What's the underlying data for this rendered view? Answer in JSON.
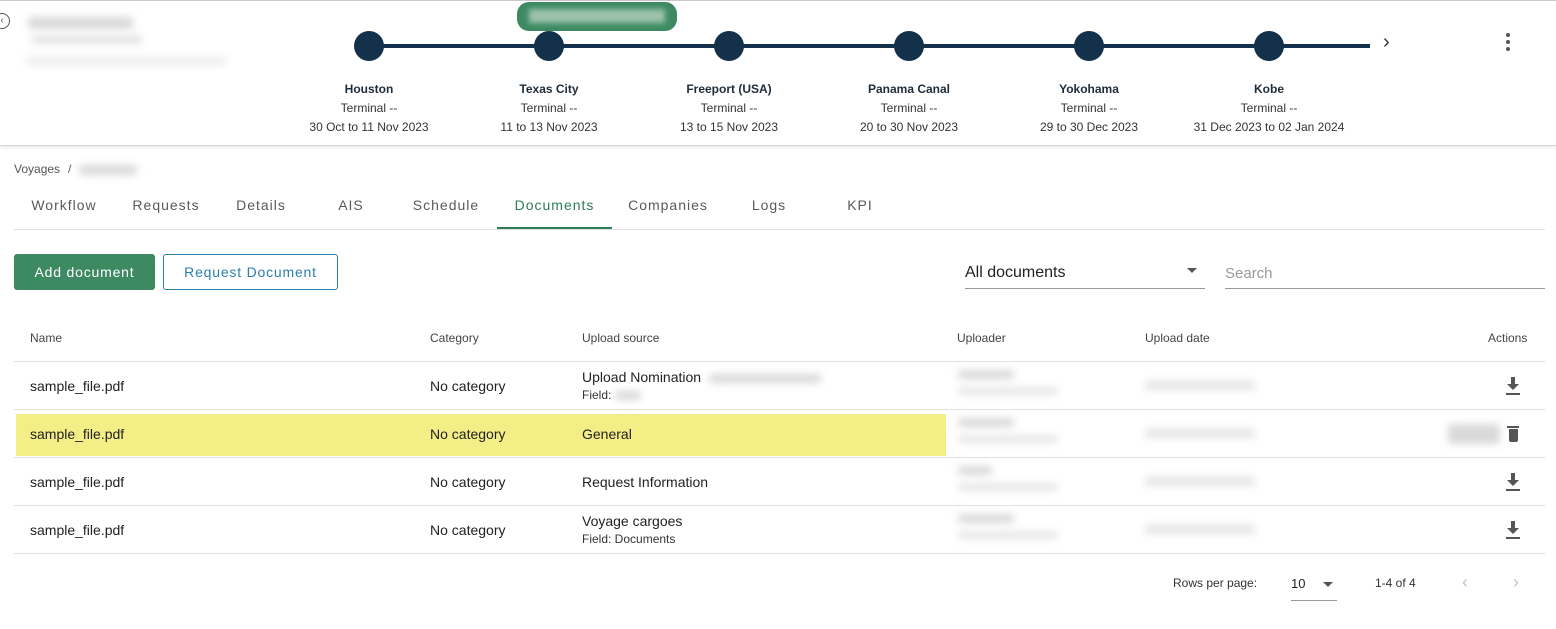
{
  "header": {
    "status_pill_text": "",
    "next_icon": "chevron-right-icon",
    "more_icon": "more-vert-icon"
  },
  "timeline": {
    "stops": [
      {
        "port": "Houston",
        "terminal": "Terminal --",
        "dates": "30 Oct to 11 Nov 2023"
      },
      {
        "port": "Texas City",
        "terminal": "Terminal --",
        "dates": "11 to 13 Nov 2023"
      },
      {
        "port": "Freeport (USA)",
        "terminal": "Terminal --",
        "dates": "13 to 15 Nov 2023"
      },
      {
        "port": "Panama Canal",
        "terminal": "Terminal --",
        "dates": "20 to 30 Nov 2023"
      },
      {
        "port": "Yokohama",
        "terminal": "Terminal --",
        "dates": "29 to 30 Dec 2023"
      },
      {
        "port": "Kobe",
        "terminal": "Terminal --",
        "dates": "31 Dec 2023 to 02 Jan 2024"
      }
    ],
    "color": "#13314a"
  },
  "breadcrumb": {
    "root": "Voyages",
    "separator": "/"
  },
  "tabs": [
    {
      "label": "Workflow",
      "active": false
    },
    {
      "label": "Requests",
      "active": false
    },
    {
      "label": "Details",
      "active": false
    },
    {
      "label": "AIS",
      "active": false
    },
    {
      "label": "Schedule",
      "active": false
    },
    {
      "label": "Documents",
      "active": true
    },
    {
      "label": "Companies",
      "active": false
    },
    {
      "label": "Logs",
      "active": false
    },
    {
      "label": "KPI",
      "active": false
    }
  ],
  "toolbar": {
    "add_label": "Add document",
    "request_label": "Request Document",
    "filter_value": "All documents",
    "search_placeholder": "Search"
  },
  "table": {
    "headers": {
      "name": "Name",
      "category": "Category",
      "source": "Upload source",
      "uploader": "Uploader",
      "date": "Upload date",
      "actions": "Actions"
    },
    "rows": [
      {
        "name": "sample_file.pdf",
        "category": "No category",
        "source": "Upload Nomination",
        "field": "Field:",
        "highlighted": false
      },
      {
        "name": "sample_file.pdf",
        "category": "No category",
        "source": "General",
        "field": "",
        "highlighted": true
      },
      {
        "name": "sample_file.pdf",
        "category": "No category",
        "source": "Request Information",
        "field": "",
        "highlighted": false
      },
      {
        "name": "sample_file.pdf",
        "category": "No category",
        "source": "Voyage cargoes",
        "field": "Field: Documents",
        "highlighted": false
      }
    ]
  },
  "pagination": {
    "rows_label": "Rows per page:",
    "rows_value": "10",
    "range": "1-4 of 4"
  },
  "colors": {
    "accent": "#3d8a62",
    "active_tab": "#2e7d57",
    "outline_button": "#2a7fae",
    "highlight": "#f3ee85"
  }
}
